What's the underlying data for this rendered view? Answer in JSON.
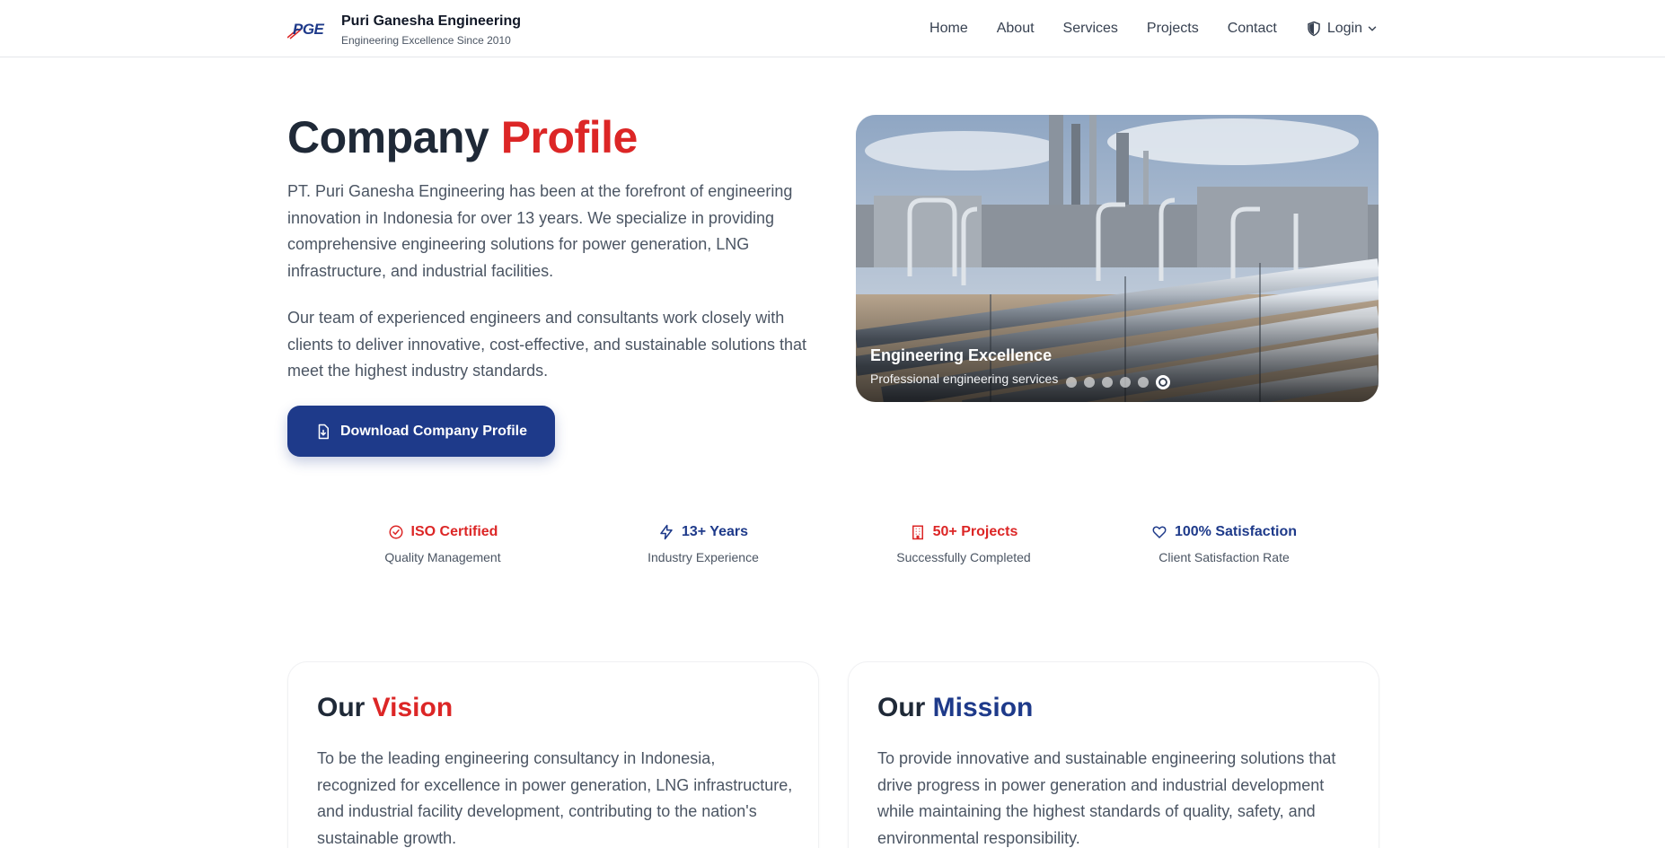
{
  "header": {
    "logo_text": "PGE",
    "brand_name": "Puri Ganesha Engineering",
    "brand_tagline": "Engineering Excellence Since 2010",
    "nav": [
      "Home",
      "About",
      "Services",
      "Projects",
      "Contact"
    ],
    "login_label": "Login"
  },
  "hero": {
    "title_main": "Company ",
    "title_accent": "Profile",
    "paragraph_1": "PT. Puri Ganesha Engineering has been at the forefront of engineering innovation in Indonesia for over 13 years. We specialize in providing comprehensive engineering solutions for power generation, LNG infrastructure, and industrial facilities.",
    "paragraph_2": "Our team of experienced engineers and consultants work closely with clients to deliver innovative, cost-effective, and sustainable solutions that meet the highest industry standards.",
    "download_label": "Download Company Profile"
  },
  "slider": {
    "title": "Engineering Excellence",
    "subtitle": "Professional engineering services",
    "total_slides": 6,
    "active_slide": 6
  },
  "stats": [
    {
      "title": "ISO Certified",
      "subtitle": "Quality Management",
      "icon": "check-circle-icon",
      "color": "#dc2626"
    },
    {
      "title": "13+ Years",
      "subtitle": "Industry Experience",
      "icon": "lightning-icon",
      "color": "#1e3a8a"
    },
    {
      "title": "50+ Projects",
      "subtitle": "Successfully Completed",
      "icon": "building-icon",
      "color": "#dc2626"
    },
    {
      "title": "100% Satisfaction",
      "subtitle": "Client Satisfaction Rate",
      "icon": "heart-icon",
      "color": "#1e3a8a"
    }
  ],
  "vision": {
    "title_main": "Our ",
    "title_accent": "Vision",
    "text": "To be the leading engineering consultancy in Indonesia, recognized for excellence in power generation, LNG infrastructure, and industrial facility development, contributing to the nation's sustainable growth."
  },
  "mission": {
    "title_main": "Our ",
    "title_accent": "Mission",
    "text": "To provide innovative and sustainable engineering solutions that drive progress in power generation and industrial development while maintaining the highest standards of quality, safety, and environmental responsibility."
  },
  "colors": {
    "primary": "#1e3a8a",
    "accent": "#dc2626",
    "text": "#1f2937",
    "muted": "#4b5563"
  }
}
